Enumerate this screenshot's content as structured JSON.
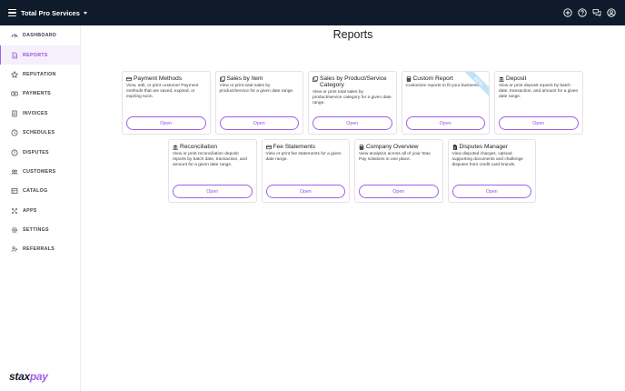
{
  "header": {
    "company": "Total Pro Services",
    "icons": [
      "add-circle-icon",
      "help-icon",
      "chat-icon",
      "account-icon"
    ]
  },
  "sidebar": {
    "items": [
      {
        "label": "DASHBOARD",
        "icon": "dashboard-icon",
        "active": false
      },
      {
        "label": "REPORTS",
        "icon": "reports-icon",
        "active": true
      },
      {
        "label": "REPUTATION",
        "icon": "star-icon",
        "active": false
      },
      {
        "label": "PAYMENTS",
        "icon": "payments-icon",
        "active": false
      },
      {
        "label": "INVOICES",
        "icon": "invoice-icon",
        "active": false
      },
      {
        "label": "SCHEDULES",
        "icon": "schedule-icon",
        "active": false
      },
      {
        "label": "DISPUTES",
        "icon": "dispute-icon",
        "active": false
      },
      {
        "label": "CUSTOMERS",
        "icon": "customers-icon",
        "active": false
      },
      {
        "label": "CATALOG",
        "icon": "catalog-icon",
        "active": false
      },
      {
        "label": "APPS",
        "icon": "apps-icon",
        "active": false
      },
      {
        "label": "SETTINGS",
        "icon": "settings-icon",
        "active": false
      },
      {
        "label": "REFERRALS",
        "icon": "referrals-icon",
        "active": false
      }
    ],
    "logo": {
      "part1": "stax",
      "part2": "pay"
    }
  },
  "main": {
    "title": "Reports",
    "open_label": "Open",
    "row1": [
      {
        "title": "Payment Methods",
        "icon": "credit-card-icon",
        "desc": "View, edit, or print customer Payment methods that are saved, expired, or expiring soon."
      },
      {
        "title": "Sales by Item",
        "icon": "copy-icon",
        "desc": "View or print total sales by product/service for a given date range."
      },
      {
        "title": "Sales by Product/Service Category",
        "icon": "copy-icon",
        "desc": "View or print total sales by product/service category for a given date range."
      },
      {
        "title": "Custom Report",
        "icon": "calculator-icon",
        "desc": "Customize reports to fit your business.",
        "ribbon": "BETA"
      },
      {
        "title": "Deposit",
        "icon": "bank-icon",
        "desc": "View or print deposit reports by batch date, transaction, and amount for a given date range."
      }
    ],
    "row2": [
      {
        "title": "Reconciliation",
        "icon": "bank-icon",
        "desc": "View or print reconciliation deposit reports by batch date, transaction, and amount for a given date range."
      },
      {
        "title": "Fee Statements",
        "icon": "credit-card-icon",
        "desc": "View or print fee statements for a given date range."
      },
      {
        "title": "Company Overview",
        "icon": "calculator-icon",
        "desc": "View analytics across all of your Stax Pay solutions in one place."
      },
      {
        "title": "Disputes Manager",
        "icon": "document-icon",
        "desc": "View disputed charges. Upload supporting documents and challenge disputes from credit card brands."
      }
    ]
  },
  "colors": {
    "topbar": "#0f1b2a",
    "accent": "#a35ee8",
    "ribbon": "#bfe3f5"
  }
}
